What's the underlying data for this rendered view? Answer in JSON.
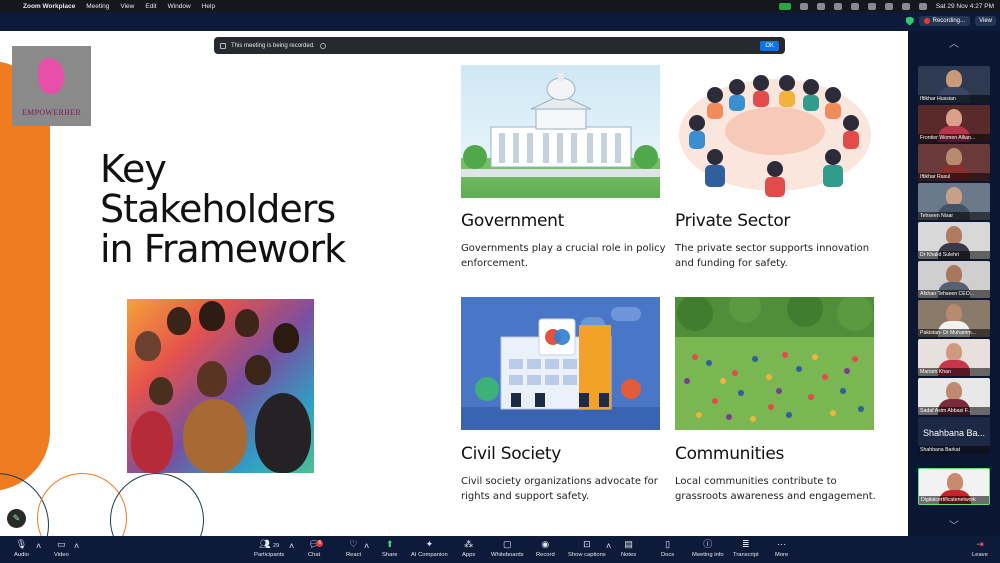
{
  "menubar": {
    "app": "Zoom Workplace",
    "items": [
      "Meeting",
      "View",
      "Edit",
      "Window",
      "Help"
    ],
    "clock": "Sat 29 Nov  4:27 PM"
  },
  "topbar": {
    "recording_label": "Recording...",
    "view_label": "View"
  },
  "notification": {
    "text": "This meeting is being recorded.",
    "ok_label": "OK"
  },
  "slide": {
    "logo_text": "EMPOWERHER",
    "title_lines": [
      "Key",
      "Stakeholders",
      "in Framework"
    ],
    "cards": [
      {
        "title": "Government",
        "desc": "Governments play a crucial role in policy enforcement."
      },
      {
        "title": "Private Sector",
        "desc": "The private sector supports innovation and funding for safety."
      },
      {
        "title": "Civil Society",
        "desc": "Civil society organizations advocate for rights and support safety."
      },
      {
        "title": "Communities",
        "desc": "Local communities contribute to grassroots awareness and engagement."
      }
    ]
  },
  "participants": [
    {
      "name": "Iftikhar Hussian"
    },
    {
      "name": "Frontier Women Allian..."
    },
    {
      "name": "Iftikhar Rasul"
    },
    {
      "name": "Tehseen Nisar"
    },
    {
      "name": "Dr Khalid Sulehri"
    },
    {
      "name": "Afshan Tehseen CEO..."
    },
    {
      "name": "Pakistan- Dr Muhamm..."
    },
    {
      "name": "Mariam Khan"
    },
    {
      "name": "Sadaf Asim Abbasi  F..."
    },
    {
      "name": "Shahbana Barkat",
      "big": "Shahbana Ba..."
    },
    {
      "name": "Digitalcertificatenetwork"
    }
  ],
  "toolbar": {
    "audio": "Audio",
    "video": "Video",
    "participants": "Participants",
    "participants_count": "29",
    "chat": "Chat",
    "chat_badge": "6",
    "react": "React",
    "share": "Share",
    "ai": "AI Companion",
    "apps": "Apps",
    "whiteboards": "Whiteboards",
    "record": "Record",
    "captions": "Show captions",
    "notes": "Notes",
    "docs": "Docs",
    "meeting_info": "Meeting info",
    "transcript": "Transcript",
    "more": "More",
    "leave": "Leave"
  },
  "colors": {
    "accent_orange": "#f07c22",
    "zoom_blue": "#0e72ed",
    "panel_navy": "#0b1633"
  }
}
